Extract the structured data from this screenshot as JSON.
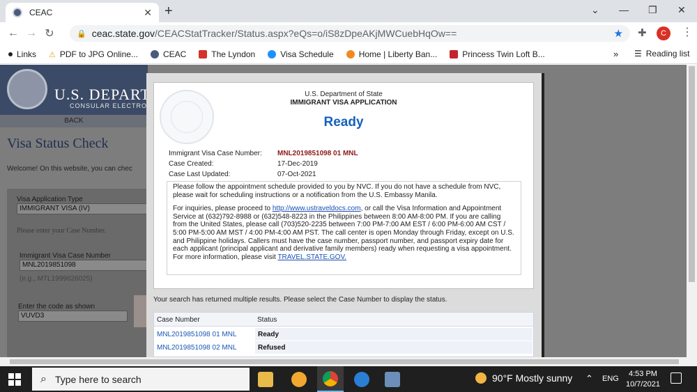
{
  "browser": {
    "tab_title": "CEAC",
    "tab_close": "✕",
    "new_tab": "+",
    "url_domain": "ceac.state.gov",
    "url_path": "/CEACStatTracker/Status.aspx?eQs=o/iS8zDpeAKjMWCuebHqOw==",
    "profile_initial": "C",
    "bookmarks": [
      "Links",
      "PDF to JPG Online...",
      "CEAC",
      "The Lyndon",
      "Visa Schedule",
      "Home | Liberty Ban...",
      "Princess Twin Loft B..."
    ],
    "bookmarks_more": "»",
    "reading_list": "Reading list"
  },
  "background_page": {
    "dept_text": "U.S. DEPART",
    "consular_text": "CONSULAR ELECTRO",
    "back_label": "BACK",
    "title": "Visa Status Check",
    "welcome": "Welcome! On this website, you can chec",
    "visa_type_label": "Visa Application Type",
    "visa_type_value": "IMMIGRANT VISA (IV)",
    "case_prompt": "Please enter your Case Number.",
    "case_label": "Immigrant Visa Case Number",
    "case_value": "MNL2019851098",
    "case_example": "(e.g., MTL1999626025)",
    "code_label": "Enter the code as shown",
    "code_value": "VUVD3"
  },
  "modal": {
    "dept": "U.S. Department of State",
    "app_type": "IMMIGRANT VISA APPLICATION",
    "status": "Ready",
    "case_number_label": "Immigrant Visa Case Number:",
    "case_number_value": "MNL2019851098 01 MNL",
    "created_label": "Case Created:",
    "created_value": "17-Dec-2019",
    "updated_label": "Case Last Updated:",
    "updated_value": "07-Oct-2021",
    "para1": "Please follow the appointment schedule provided to you by NVC. If you do not have a schedule from NVC, please wait for scheduling instructions or a notification from the U.S. Embassy Manila.",
    "para2_pre": "For inquiries, please proceed to ",
    "para2_link": "http://www.ustraveldocs.com",
    "para2_post": ", or call the Visa Information and Appointment Service at (632)792-8988 or (632)548-8223 in the Philippines between 8:00 AM-8:00 PM. If you are calling from the United States, please call (703)520-2235 between 7:00 PM-7:00 AM EST / 6:00 PM-6:00 AM CST / 5:00 PM-5:00 AM MST / 4:00 PM-4:00 AM PST. The call center is open Monday through Friday, except on U.S. and Philippine holidays. Callers must have the case number, passport number, and passport expiry date for each applicant (principal applicant and derivative family members) ready when requesting a visa appointment.",
    "para3_pre": "For more information, please visit ",
    "para3_link": "TRAVEL.STATE.GOV.",
    "multi_results": "Your search has returned multiple results. Please select the Case Number to display the status.",
    "col_case": "Case Number",
    "col_status": "Status",
    "rows": [
      {
        "case": "MNL2019851098 01 MNL",
        "status": "Ready"
      },
      {
        "case": "MNL2019851098 02 MNL",
        "status": "Refused"
      }
    ]
  },
  "taskbar": {
    "search_placeholder": "Type here to search",
    "weather": "90°F  Mostly sunny",
    "lang": "ENG",
    "time": "4:53 PM",
    "date": "10/7/2021"
  }
}
